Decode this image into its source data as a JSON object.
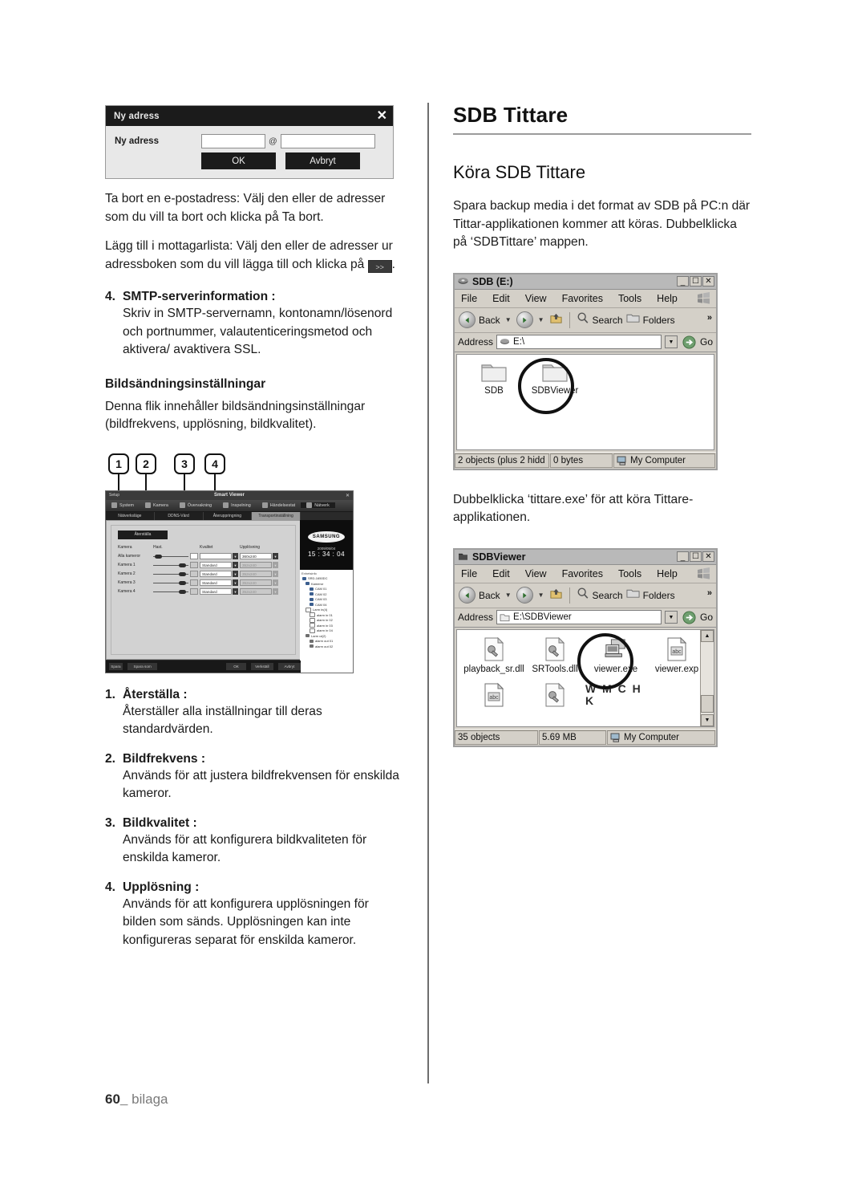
{
  "page": {
    "number": "60_",
    "footer_label": "bilaga"
  },
  "left": {
    "dialog": {
      "title": "Ny adress",
      "close_icon": "close-icon",
      "field_label": "Ny adress",
      "local_value": "",
      "at_symbol": "@",
      "domain_value": "",
      "ok_label": "OK",
      "cancel_label": "Avbryt"
    },
    "paragraphs": [
      "Ta bort en e-postadress: Välj den eller de adresser som du vill ta bort och klicka på Ta bort.",
      "Lägg till i mottagarlista: Välj den eller de adresser ur adressboken som du vill lägga till och klicka på"
    ],
    "inline_button_label": ">>",
    "inline_trailing": ".",
    "smtp_item": {
      "number": "4.",
      "title": "SMTP-serverinformation :",
      "body": "Skriv in SMTP-servernamn, kontonamn/lösenord och portnummer, valautenticeringsmetod och aktivera/ avaktivera SSL."
    },
    "section": {
      "heading": "Bildsändningsinställningar",
      "body": "Denna flik innehåller bildsändningsinställningar (bildfrekvens, upplösning, bildkvalitet)."
    },
    "badges": [
      "1",
      "2",
      "3",
      "4"
    ],
    "smart_viewer": {
      "window_title_left": "Setup",
      "window_title_center": "Smart Viewer",
      "close_icon": "close-icon",
      "menus": [
        {
          "label": "System",
          "icon": "system-icon"
        },
        {
          "label": "Kamera",
          "icon": "camera-icon"
        },
        {
          "label": "Övervakning",
          "icon": "monitor-icon"
        },
        {
          "label": "Inspelning",
          "icon": "record-icon"
        },
        {
          "label": "Händelsestat",
          "icon": "event-icon"
        },
        {
          "label": "Nätverk",
          "icon": "network-icon"
        }
      ],
      "tabs": [
        {
          "label": "Nätverksläge",
          "active": false
        },
        {
          "label": "DDNS-Värd",
          "active": false
        },
        {
          "label": "Återuppringning",
          "active": false
        },
        {
          "label": "Transportinställning",
          "active": true
        }
      ],
      "reset_button": "Återställa",
      "table": {
        "headers": [
          "Kamera",
          "Hast.",
          "Kvalitet",
          "Upplösning"
        ],
        "rows": [
          {
            "camera": "Alla kameror",
            "quality": "",
            "resolution": "360x240",
            "dim": false
          },
          {
            "camera": "Kamera 1",
            "quality": "Standard",
            "resolution": "352x240",
            "dim": true
          },
          {
            "camera": "Kamera 2",
            "quality": "Standard",
            "resolution": "352x240",
            "dim": true
          },
          {
            "camera": "Kamera 3",
            "quality": "Standard",
            "resolution": "352x240",
            "dim": true
          },
          {
            "camera": "Kamera 4",
            "quality": "Standard",
            "resolution": "352x240",
            "dim": true
          }
        ]
      },
      "brand": "SAMSUNG",
      "date": "2009/05/04",
      "time": "15 : 34 : 04",
      "tree_header": "Enhetsinfo",
      "tree": [
        {
          "label": "SRD-1650DC",
          "indent": 0,
          "chip": "blue"
        },
        {
          "label": "Kameror",
          "indent": 1,
          "chip": "blue"
        },
        {
          "label": "CAM 01",
          "indent": 2,
          "chip": "blue"
        },
        {
          "label": "CAM 02",
          "indent": 2,
          "chip": "blue"
        },
        {
          "label": "CAM 03",
          "indent": 2,
          "chip": "blue"
        },
        {
          "label": "CAM 04",
          "indent": 2,
          "chip": "blue"
        },
        {
          "label": "Larm in(4)",
          "indent": 1,
          "chip": "box"
        },
        {
          "label": "alarm in 01",
          "indent": 2,
          "chip": "box"
        },
        {
          "label": "alarm in 02",
          "indent": 2,
          "chip": "box"
        },
        {
          "label": "alarm in 03",
          "indent": 2,
          "chip": "box"
        },
        {
          "label": "alarm in 04",
          "indent": 2,
          "chip": "box"
        },
        {
          "label": "Larm ut(2)",
          "indent": 1,
          "chip": "gray"
        },
        {
          "label": "alarm out 01",
          "indent": 2,
          "chip": "gray"
        },
        {
          "label": "alarm out 02",
          "indent": 2,
          "chip": "gray"
        }
      ],
      "footer_buttons": [
        "Spara",
        "Spara som",
        "OK",
        "Verkställ",
        "Avbryt"
      ]
    },
    "numbered_items": [
      {
        "number": "1.",
        "title": "Återställa :",
        "body": "Återställer alla inställningar till deras standardvärden."
      },
      {
        "number": "2.",
        "title": "Bildfrekvens :",
        "body": "Används för att justera bildfrekvensen för enskilda kameror."
      },
      {
        "number": "3.",
        "title": "Bildkvalitet :",
        "body": "Används för att konfigurera bildkvaliteten för enskilda kameror."
      },
      {
        "number": "4.",
        "title": "Upplösning :",
        "body": "Används för att konfigurera upplösningen för bilden som sänds. Upplösningen kan inte konfigureras separat för enskilda kameror."
      }
    ]
  },
  "right": {
    "title": "SDB Tittare",
    "subtitle": "Köra SDB Tittare",
    "intro": "Spara backup media i det format av SDB på PC:n där Tittar-applikationen kommer att köras. Dubbelklicka på ‘SDBTittare’ mappen.",
    "middle_text": "Dubbelklicka ‘tittare.exe’ för att köra Tittare-applikationen.",
    "window1": {
      "title": "SDB (E:)",
      "title_icon": "drive-icon",
      "minimize_label": "_",
      "maximize_label": "❐",
      "close_label": "✕",
      "menus": [
        "File",
        "Edit",
        "View",
        "Favorites",
        "Tools",
        "Help"
      ],
      "toolbar": {
        "back_label": "Back",
        "forward_icon": "forward-arrow-icon",
        "up_icon": "up-folder-icon",
        "search_label": "Search",
        "folders_label": "Folders",
        "chevron_label": "»"
      },
      "address_label": "Address",
      "address_value": "E:\\",
      "address_icon": "drive-icon",
      "go_label": "Go",
      "files": [
        {
          "name": "SDB",
          "type": "folder",
          "highlighted": false
        },
        {
          "name": "SDBViewer",
          "type": "folder",
          "highlighted": true
        }
      ],
      "status": [
        "2 objects (plus 2 hidd",
        "0 bytes",
        "My Computer"
      ]
    },
    "window2": {
      "title": "SDBViewer",
      "title_icon": "folder-icon",
      "minimize_label": "_",
      "maximize_label": "❐",
      "close_label": "✕",
      "menus": [
        "File",
        "Edit",
        "View",
        "Favorites",
        "Tools",
        "Help"
      ],
      "toolbar": {
        "back_label": "Back",
        "forward_icon": "forward-arrow-icon",
        "up_icon": "up-folder-icon",
        "search_label": "Search",
        "folders_label": "Folders",
        "chevron_label": "»"
      },
      "address_label": "Address",
      "address_value": "E:\\SDBViewer",
      "address_icon": "folder-icon",
      "go_label": "Go",
      "files": [
        {
          "name": "playback_sr.dll",
          "type": "dll",
          "highlighted": false
        },
        {
          "name": "SRTools.dll",
          "type": "dll",
          "highlighted": false
        },
        {
          "name": "viewer.exe",
          "type": "exe",
          "highlighted": true
        },
        {
          "name": "viewer.exp",
          "type": "doc",
          "highlighted": false
        },
        {
          "name": "",
          "type": "doc",
          "highlighted": false
        },
        {
          "name": "",
          "type": "dll",
          "highlighted": false
        }
      ],
      "watermark": "W M\nC H K",
      "status": [
        "35 objects",
        "5.69 MB",
        "My Computer"
      ]
    }
  }
}
